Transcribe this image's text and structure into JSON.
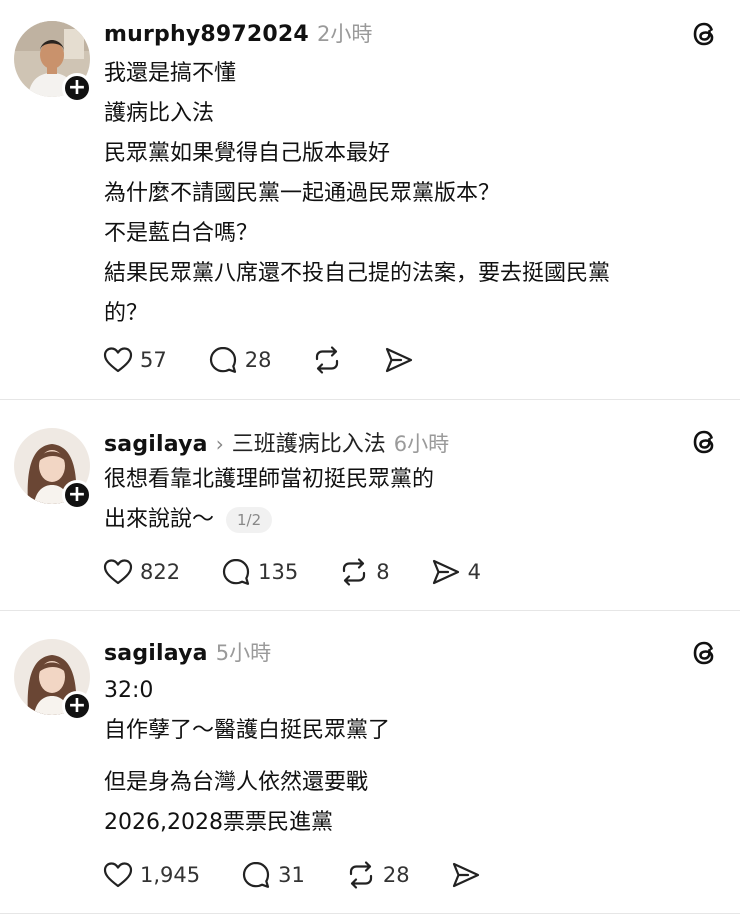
{
  "posts": [
    {
      "username": "murphy8972024",
      "time": "2小時",
      "lines": [
        "我還是搞不懂",
        "護病比入法",
        "民眾黨如果覺得自己版本最好",
        "為什麼不請國民黨一起通過民眾黨版本？",
        "不是藍白合嗎？",
        "結果民眾黨八席還不投自己提的法案，要去挺國民黨",
        "的？"
      ],
      "likes": "57",
      "replies": "28",
      "reposts": "",
      "shares": ""
    },
    {
      "username": "sagilaya",
      "reply_to": "三班護病比入法",
      "time": "6小時",
      "lines": [
        "很想看靠北護理師當初挺民眾黨的",
        "出來說說～"
      ],
      "pager": "1/2",
      "likes": "822",
      "replies": "135",
      "reposts": "8",
      "shares": "4"
    },
    {
      "username": "sagilaya",
      "time": "5小時",
      "lines": [
        "32:0",
        "自作孽了～醫護白挺民眾黨了",
        "但是身為台灣人依然還要戰",
        "2026,2028票票民進黨"
      ],
      "likes": "1,945",
      "replies": "31",
      "reposts": "28",
      "shares": ""
    }
  ],
  "icons": {
    "avatar_badge": "plus-icon",
    "app": "threads-logo-icon",
    "like": "heart-icon",
    "reply": "comment-icon",
    "repost": "repost-icon",
    "share": "send-icon"
  },
  "colors": {
    "text": "#111111",
    "muted": "#9a9a9a",
    "divider": "#e6e6e6",
    "badge": "#111111"
  }
}
